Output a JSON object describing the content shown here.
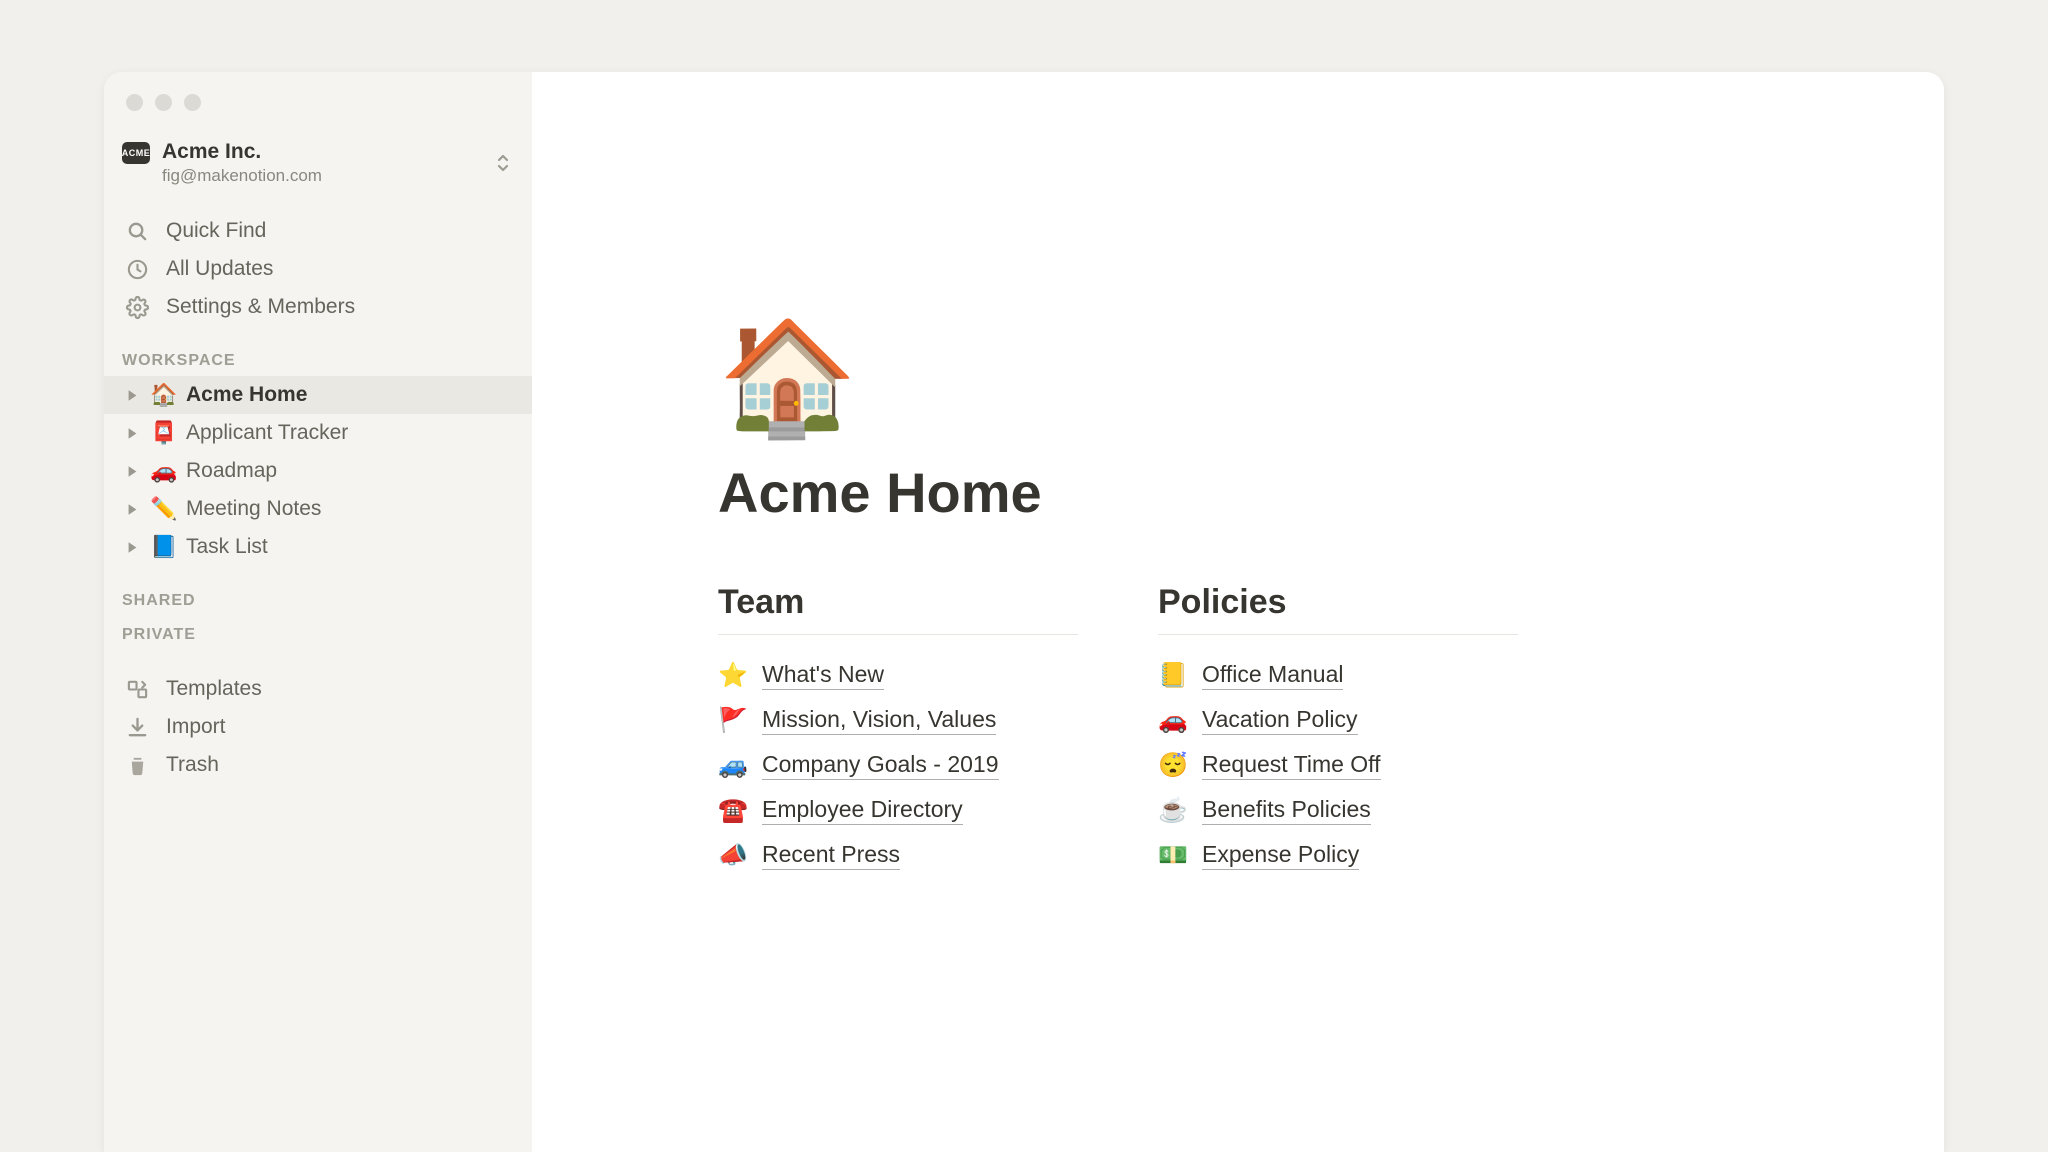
{
  "workspace": {
    "badge": "ACME",
    "name": "Acme Inc.",
    "email": "fig@makenotion.com"
  },
  "nav": {
    "quick_find": "Quick Find",
    "all_updates": "All Updates",
    "settings": "Settings & Members"
  },
  "sections": {
    "workspace": "WORKSPACE",
    "shared": "SHARED",
    "private": "PRIVATE"
  },
  "pages": [
    {
      "emoji": "🏠",
      "label": "Acme Home",
      "active": true
    },
    {
      "emoji": "📮",
      "label": "Applicant Tracker",
      "active": false
    },
    {
      "emoji": "🚗",
      "label": "Roadmap",
      "active": false
    },
    {
      "emoji": "✏️",
      "label": "Meeting Notes",
      "active": false
    },
    {
      "emoji": "📘",
      "label": "Task List",
      "active": false
    }
  ],
  "bottom_nav": {
    "templates": "Templates",
    "import": "Import",
    "trash": "Trash"
  },
  "page": {
    "hero_emoji": "🏠",
    "title": "Acme Home",
    "columns": [
      {
        "title": "Team",
        "links": [
          {
            "emoji": "⭐",
            "text": "What's New"
          },
          {
            "emoji": "🚩",
            "text": "Mission, Vision, Values"
          },
          {
            "emoji": "🚙",
            "text": "Company Goals - 2019"
          },
          {
            "emoji": "☎️",
            "text": "Employee Directory"
          },
          {
            "emoji": "📣",
            "text": "Recent Press"
          }
        ]
      },
      {
        "title": "Policies",
        "links": [
          {
            "emoji": "📒",
            "text": "Office Manual"
          },
          {
            "emoji": "🚗",
            "text": "Vacation Policy"
          },
          {
            "emoji": "😴",
            "text": "Request Time Off"
          },
          {
            "emoji": "☕",
            "text": "Benefits Policies"
          },
          {
            "emoji": "💵",
            "text": "Expense Policy"
          }
        ]
      }
    ]
  }
}
